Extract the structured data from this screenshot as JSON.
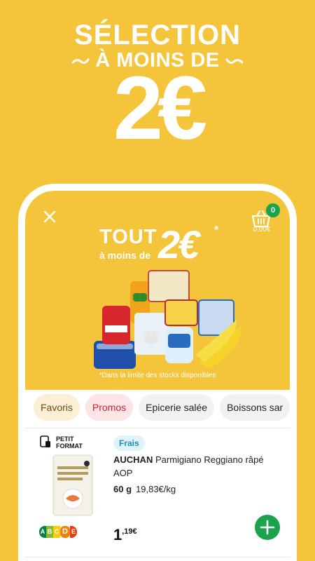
{
  "promo": {
    "line1": "SÉLECTION",
    "line2": "À MOINS DE",
    "price": "2€"
  },
  "header": {
    "cart_count": "0",
    "cart_total": "0,00€"
  },
  "banner": {
    "tout": "TOUT",
    "a_moins_de": "à moins de",
    "big_price": "2€",
    "asterisk": "*",
    "stock_note": "*Dans la limite des stocks disponibles"
  },
  "categories": [
    "Favoris",
    "Promos",
    "Epicerie salée",
    "Boissons sar"
  ],
  "product": {
    "format_label": "PETIT FORMAT",
    "tag": "Frais",
    "brand": "AUCHAN",
    "name": "Parmigiano Reggiano râpé AOP",
    "weight": "60 g",
    "unit_price": "19,83€/kg",
    "price_main": "1",
    "price_cents": ",19€",
    "nutriscore": [
      "A",
      "B",
      "C",
      "D",
      "E"
    ],
    "nutriscore_current": "D"
  },
  "colors": {
    "background": "#F4C43A",
    "accent_green": "#1BA34B",
    "promo_red": "#D6202F",
    "frais_blue": "#1E8EB3"
  },
  "icons": [
    "close-icon",
    "basket-icon",
    "petit-format-icon",
    "plus-icon"
  ]
}
